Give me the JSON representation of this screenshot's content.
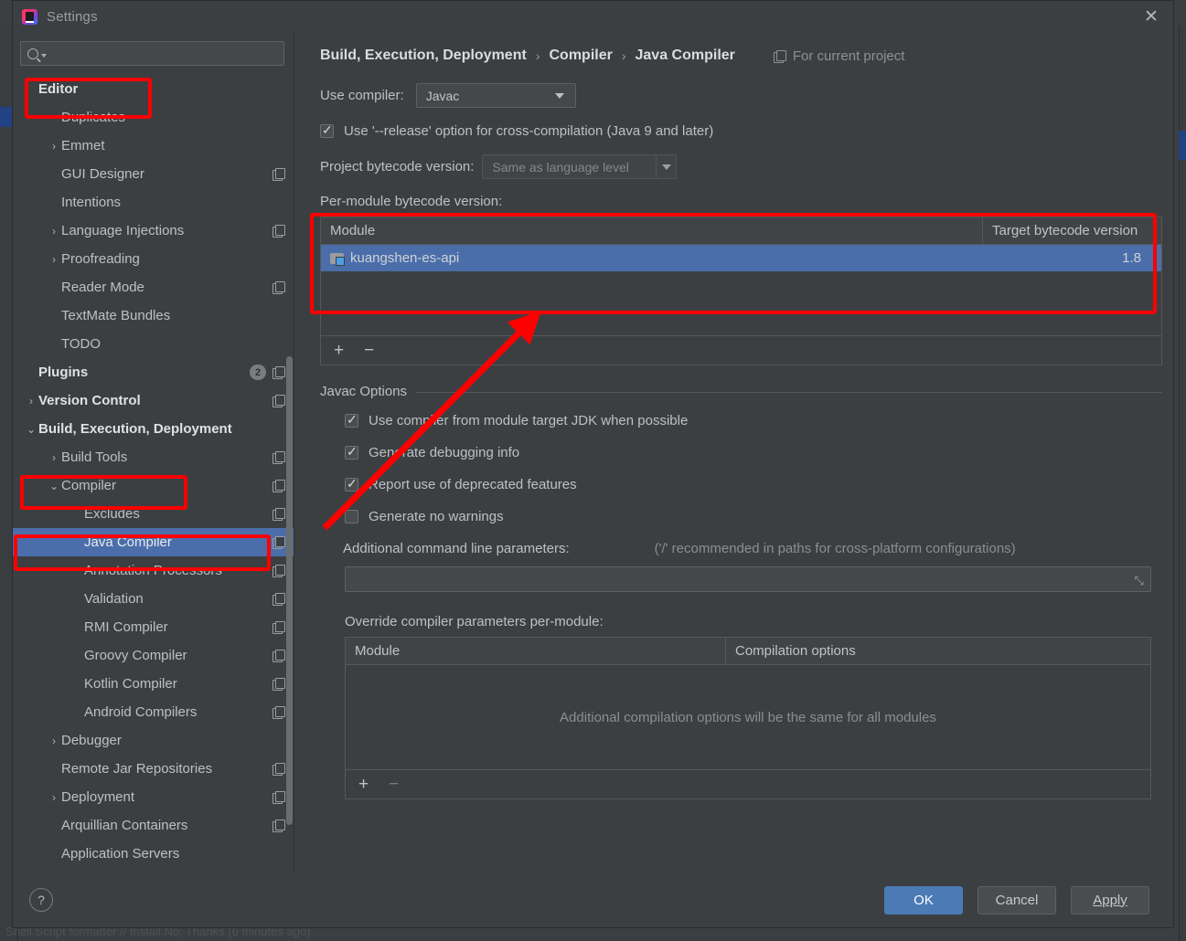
{
  "window": {
    "title": "Settings",
    "logo_icon": "intellij-idea-logo",
    "close_icon": "close-icon"
  },
  "background": {
    "notification_text": "Shell Script formatter // Install  No, Thanks (6 minutes ago)"
  },
  "search": {
    "placeholder": "",
    "value": "",
    "icon": "search-icon"
  },
  "sidebar": {
    "items": [
      {
        "label": "Editor",
        "indent": 0,
        "bold": true,
        "chevron": "",
        "copy": false,
        "selected": false
      },
      {
        "label": "Duplicates",
        "indent": 1,
        "bold": false,
        "chevron": "",
        "copy": false,
        "selected": false
      },
      {
        "label": "Emmet",
        "indent": 1,
        "bold": false,
        "chevron": "›",
        "copy": false,
        "selected": false
      },
      {
        "label": "GUI Designer",
        "indent": 1,
        "bold": false,
        "chevron": "",
        "copy": true,
        "selected": false
      },
      {
        "label": "Intentions",
        "indent": 1,
        "bold": false,
        "chevron": "",
        "copy": false,
        "selected": false
      },
      {
        "label": "Language Injections",
        "indent": 1,
        "bold": false,
        "chevron": "›",
        "copy": true,
        "selected": false
      },
      {
        "label": "Proofreading",
        "indent": 1,
        "bold": false,
        "chevron": "›",
        "copy": false,
        "selected": false
      },
      {
        "label": "Reader Mode",
        "indent": 1,
        "bold": false,
        "chevron": "",
        "copy": true,
        "selected": false
      },
      {
        "label": "TextMate Bundles",
        "indent": 1,
        "bold": false,
        "chevron": "",
        "copy": false,
        "selected": false
      },
      {
        "label": "TODO",
        "indent": 1,
        "bold": false,
        "chevron": "",
        "copy": false,
        "selected": false
      },
      {
        "label": "Plugins",
        "indent": 0,
        "bold": true,
        "chevron": "",
        "copy": true,
        "selected": false,
        "badge": "2"
      },
      {
        "label": "Version Control",
        "indent": 0,
        "bold": true,
        "chevron": "›",
        "copy": true,
        "selected": false
      },
      {
        "label": "Build, Execution, Deployment",
        "indent": 0,
        "bold": true,
        "chevron": "⌄",
        "copy": false,
        "selected": false
      },
      {
        "label": "Build Tools",
        "indent": 1,
        "bold": false,
        "chevron": "›",
        "copy": true,
        "selected": false
      },
      {
        "label": "Compiler",
        "indent": 1,
        "bold": false,
        "chevron": "⌄",
        "copy": true,
        "selected": false
      },
      {
        "label": "Excludes",
        "indent": 2,
        "bold": false,
        "chevron": "",
        "copy": true,
        "selected": false
      },
      {
        "label": "Java Compiler",
        "indent": 2,
        "bold": false,
        "chevron": "",
        "copy": true,
        "selected": true
      },
      {
        "label": "Annotation Processors",
        "indent": 2,
        "bold": false,
        "chevron": "",
        "copy": true,
        "selected": false
      },
      {
        "label": "Validation",
        "indent": 2,
        "bold": false,
        "chevron": "",
        "copy": true,
        "selected": false
      },
      {
        "label": "RMI Compiler",
        "indent": 2,
        "bold": false,
        "chevron": "",
        "copy": true,
        "selected": false
      },
      {
        "label": "Groovy Compiler",
        "indent": 2,
        "bold": false,
        "chevron": "",
        "copy": true,
        "selected": false
      },
      {
        "label": "Kotlin Compiler",
        "indent": 2,
        "bold": false,
        "chevron": "",
        "copy": true,
        "selected": false
      },
      {
        "label": "Android Compilers",
        "indent": 2,
        "bold": false,
        "chevron": "",
        "copy": true,
        "selected": false
      },
      {
        "label": "Debugger",
        "indent": 1,
        "bold": false,
        "chevron": "›",
        "copy": false,
        "selected": false
      },
      {
        "label": "Remote Jar Repositories",
        "indent": 1,
        "bold": false,
        "chevron": "",
        "copy": true,
        "selected": false
      },
      {
        "label": "Deployment",
        "indent": 1,
        "bold": false,
        "chevron": "›",
        "copy": true,
        "selected": false
      },
      {
        "label": "Arquillian Containers",
        "indent": 1,
        "bold": false,
        "chevron": "",
        "copy": true,
        "selected": false
      },
      {
        "label": "Application Servers",
        "indent": 1,
        "bold": false,
        "chevron": "",
        "copy": false,
        "selected": false
      }
    ]
  },
  "main": {
    "breadcrumb": [
      "Build, Execution, Deployment",
      "Compiler",
      "Java Compiler"
    ],
    "breadcrumb_separator": "›",
    "for_current_project": "For current project",
    "for_current_project_icon": "copy-settings-icon",
    "use_compiler_label": "Use compiler:",
    "use_compiler_value": "Javac",
    "use_release_option": {
      "label": "Use '--release' option for cross-compilation (Java 9 and later)",
      "checked": true
    },
    "project_bytecode_label": "Project bytecode version:",
    "project_bytecode_value": "Same as language level",
    "per_module_label": "Per-module bytecode version:",
    "module_table": {
      "columns": [
        "Module",
        "Target bytecode version"
      ],
      "rows": [
        {
          "module": "kuangshen-es-api",
          "version": "1.8",
          "icon": "module-icon",
          "selected": true
        }
      ],
      "add_label": "+",
      "remove_label": "−"
    },
    "javac_options_title": "Javac Options",
    "javac_options": [
      {
        "label": "Use compiler from module target JDK when possible",
        "checked": true
      },
      {
        "label": "Generate debugging info",
        "checked": true
      },
      {
        "label": "Report use of deprecated features",
        "checked": true
      },
      {
        "label": "Generate no warnings",
        "checked": false
      }
    ],
    "additional_params_label": "Additional command line parameters:",
    "additional_params_hint": "('/' recommended in paths for cross-platform configurations)",
    "additional_params_value": "",
    "override_label": "Override compiler parameters per-module:",
    "override_table": {
      "columns": [
        "Module",
        "Compilation options"
      ],
      "empty_message": "Additional compilation options will be the same for all modules",
      "add_label": "+",
      "remove_label": "−"
    }
  },
  "buttons": {
    "help": "?",
    "ok": "OK",
    "cancel": "Cancel",
    "apply": "Apply"
  },
  "annotations": {
    "color": "#fe0000",
    "boxes": [
      "editor-item",
      "module-table",
      "compiler-item",
      "java-compiler-item"
    ],
    "arrow": "red-arrow-pointing-to-module-table"
  }
}
